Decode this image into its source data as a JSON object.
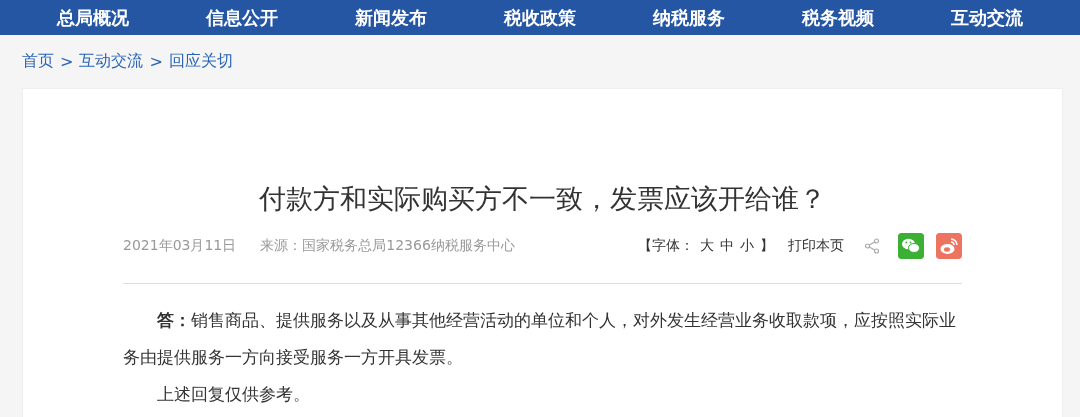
{
  "nav": [
    {
      "label": "总局概况"
    },
    {
      "label": "信息公开"
    },
    {
      "label": "新闻发布"
    },
    {
      "label": "税收政策"
    },
    {
      "label": "纳税服务"
    },
    {
      "label": "税务视频"
    },
    {
      "label": "互动交流"
    }
  ],
  "breadcrumb": {
    "items": [
      "首页",
      "互动交流",
      "回应关切"
    ],
    "separator": ">"
  },
  "article": {
    "title": "付款方和实际购买方不一致，发票应该开给谁？",
    "date": "2021年03月11日",
    "source": "来源：国家税务总局12366纳税服务中心",
    "font_size": {
      "prefix": "【字体：",
      "options": [
        "大",
        "中",
        "小"
      ],
      "suffix": "】"
    },
    "print": "打印本页",
    "paragraphs": [
      "**答：**销售商品、提供服务以及从事其他经营活动的单位和个人，对外发生经营业务收取款项，应按照实际业务由提供服务一方向接受服务一方开具发票。",
      "上述回复仅供参考。"
    ]
  }
}
